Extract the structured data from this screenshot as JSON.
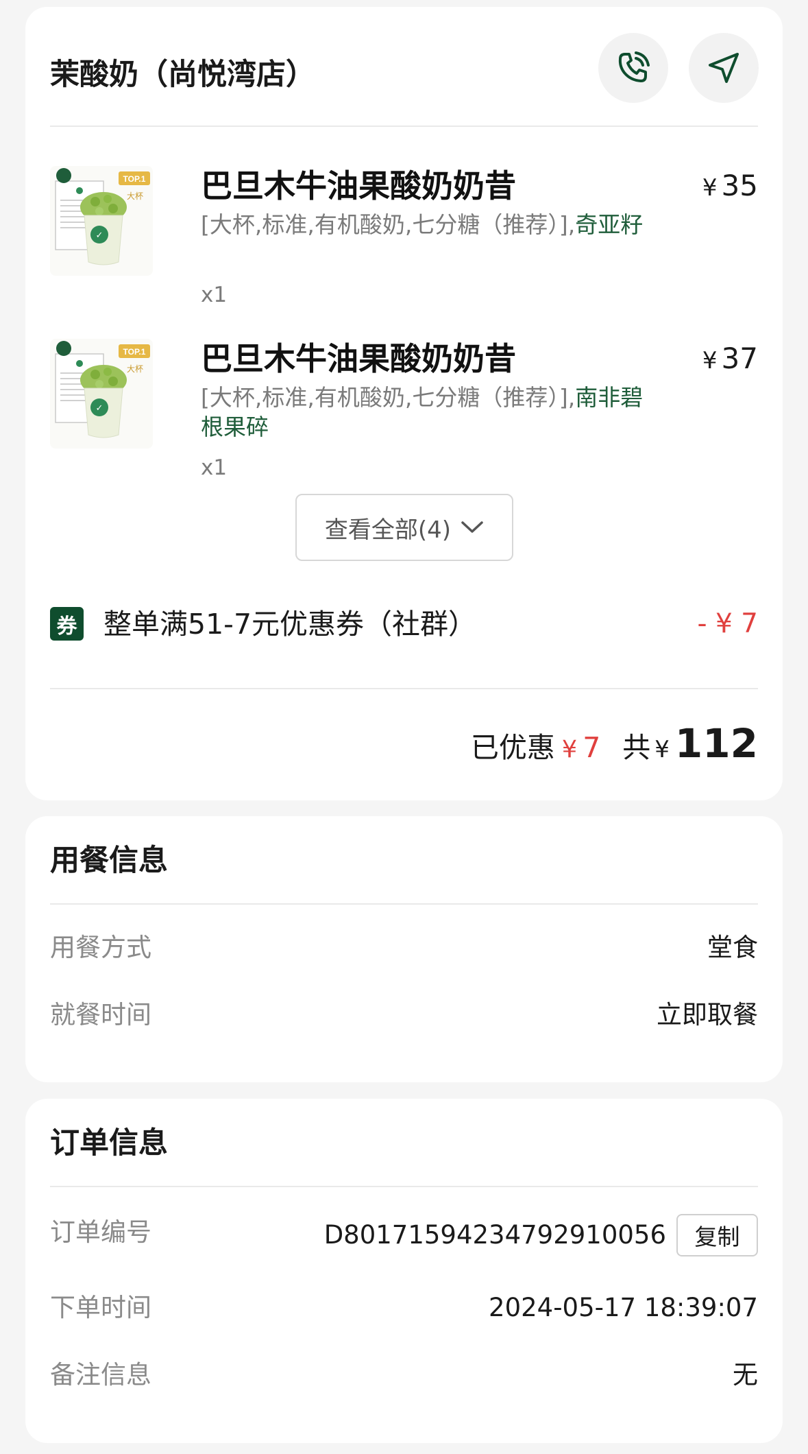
{
  "store": {
    "name": "茉酸奶（尚悦湾店）",
    "call_icon": "phone-call-icon",
    "nav_icon": "navigation-arrow-icon"
  },
  "items": [
    {
      "name": "巴旦木牛油果酸奶奶昔",
      "price_symbol": "¥",
      "price": "35",
      "spec": "[大杯,标准,有机酸奶,七分糖（推荐）],",
      "addon": "奇亚籽",
      "qty": "x1"
    },
    {
      "name": "巴旦木牛油果酸奶奶昔",
      "price_symbol": "¥",
      "price": "37",
      "spec": "[大杯,标准,有机酸奶,七分糖（推荐）],",
      "addon": "南非碧根果碎",
      "qty": "x1"
    }
  ],
  "thumb_labels": {
    "top": "TOP.1",
    "size": "大杯"
  },
  "view_all": "查看全部(4)",
  "coupon": {
    "badge": "券",
    "text": "整单满51-7元优惠券（社群）",
    "amount": "- ¥ 7"
  },
  "summary": {
    "discount_label": "已优惠",
    "discount_symbol": "¥",
    "discount_value": "7",
    "total_label": "共",
    "total_symbol": "¥",
    "total_value": "112"
  },
  "dining": {
    "title": "用餐信息",
    "rows": [
      {
        "label": "用餐方式",
        "value": "堂食"
      },
      {
        "label": "就餐时间",
        "value": "立即取餐"
      }
    ]
  },
  "order_info": {
    "title": "订单信息",
    "order_no_label": "订单编号",
    "order_no": "D80171594234792910056",
    "copy_label": "复制",
    "time_label": "下单时间",
    "time": "2024-05-17 18:39:07",
    "note_label": "备注信息",
    "note": "无"
  },
  "colors": {
    "brand_green": "#0f4d2e",
    "addon_green": "#1f5d3a",
    "discount_red": "#e0403e"
  }
}
